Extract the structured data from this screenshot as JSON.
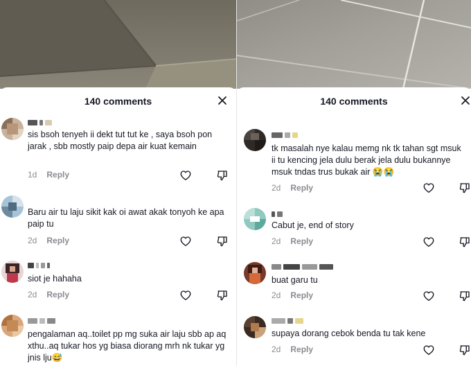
{
  "left_panel": {
    "header": {
      "title": "140 comments"
    },
    "comments": [
      {
        "text": "sis bsoh tenyeh ii dekt tut tut ke , saya bsoh pon jarak , sbb mostly paip depa air kuat kemain",
        "time": "1d",
        "reply_label": "Reply"
      },
      {
        "text": "Baru air tu laju sikit kak oi awat akak tonyoh ke apa paip tu",
        "time": "2d",
        "reply_label": "Reply"
      },
      {
        "text": "siot je hahaha",
        "time": "2d",
        "reply_label": "Reply"
      },
      {
        "text": "pengalaman aq..toilet pp mg suka air laju sbb ap aq xthu..aq tukar hos yg biasa diorang mrh nk tukar yg jnis lju😅",
        "time": "",
        "reply_label": ""
      }
    ]
  },
  "right_panel": {
    "header": {
      "title": "140 comments"
    },
    "comments": [
      {
        "text": "tk masalah nye kalau memg nk tk tahan sgt msuk ii tu kencing jela dulu berak jela dulu bukannye msuk tndas trus bukak air 😭😭",
        "time": "2d",
        "reply_label": "Reply"
      },
      {
        "text": "Cabut je, end of story",
        "time": "2d",
        "reply_label": "Reply"
      },
      {
        "text": "buat garu tu",
        "time": "2d",
        "reply_label": "Reply"
      },
      {
        "text": "supaya dorang cebok benda tu tak kene",
        "time": "2d",
        "reply_label": "Reply"
      }
    ]
  },
  "icons": {
    "close": "close-icon",
    "like": "heart-outline-icon",
    "dislike": "thumbs-down-icon"
  },
  "colors": {
    "text": "#161823",
    "meta": "#8a8b91",
    "divider": "#e6e6e6"
  }
}
